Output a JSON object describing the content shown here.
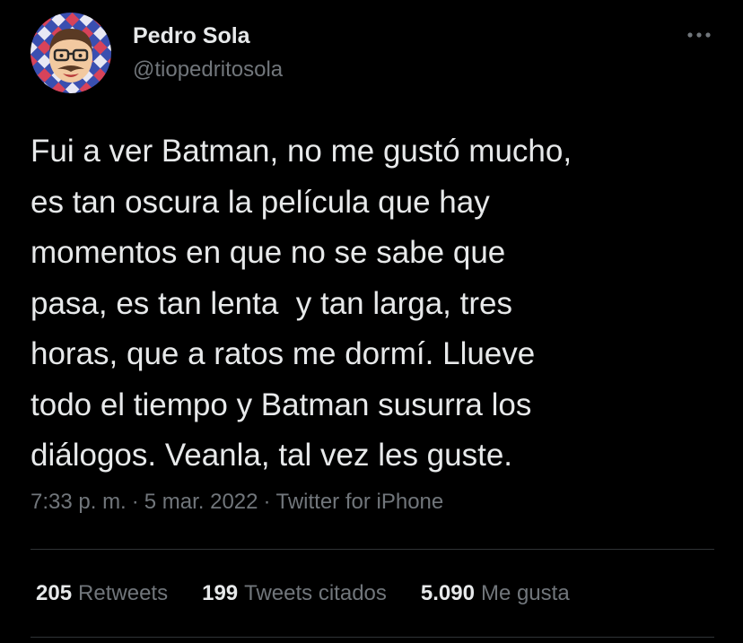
{
  "user": {
    "display_name": "Pedro Sola",
    "handle": "@tiopedritosola",
    "avatar": "cartoon-man-with-glasses-and-mustache"
  },
  "tweet": {
    "lines": [
      "Fui a ver Batman, no me gustó mucho,",
      "es tan oscura la película que hay",
      "momentos en que no se sabe que",
      "pasa, es tan lenta  y tan larga, tres",
      "horas, que a ratos me dormí. Llueve",
      "todo el tiempo y Batman susurra los",
      "diálogos. Veanla, tal vez les guste."
    ],
    "time": "7:33 p. m.",
    "date": "5 mar. 2022",
    "separator": "·",
    "source": "Twitter for iPhone"
  },
  "stats": {
    "retweets_count": "205",
    "retweets_label": "Retweets",
    "quotes_count": "199",
    "quotes_label": "Tweets citados",
    "likes_count": "5.090",
    "likes_label": "Me gusta"
  },
  "colors": {
    "background": "#000000",
    "primary_text": "#e7e9ea",
    "secondary_text": "#71767b",
    "divider": "#2f3336"
  },
  "icons": {
    "more": "more-options-icon"
  }
}
